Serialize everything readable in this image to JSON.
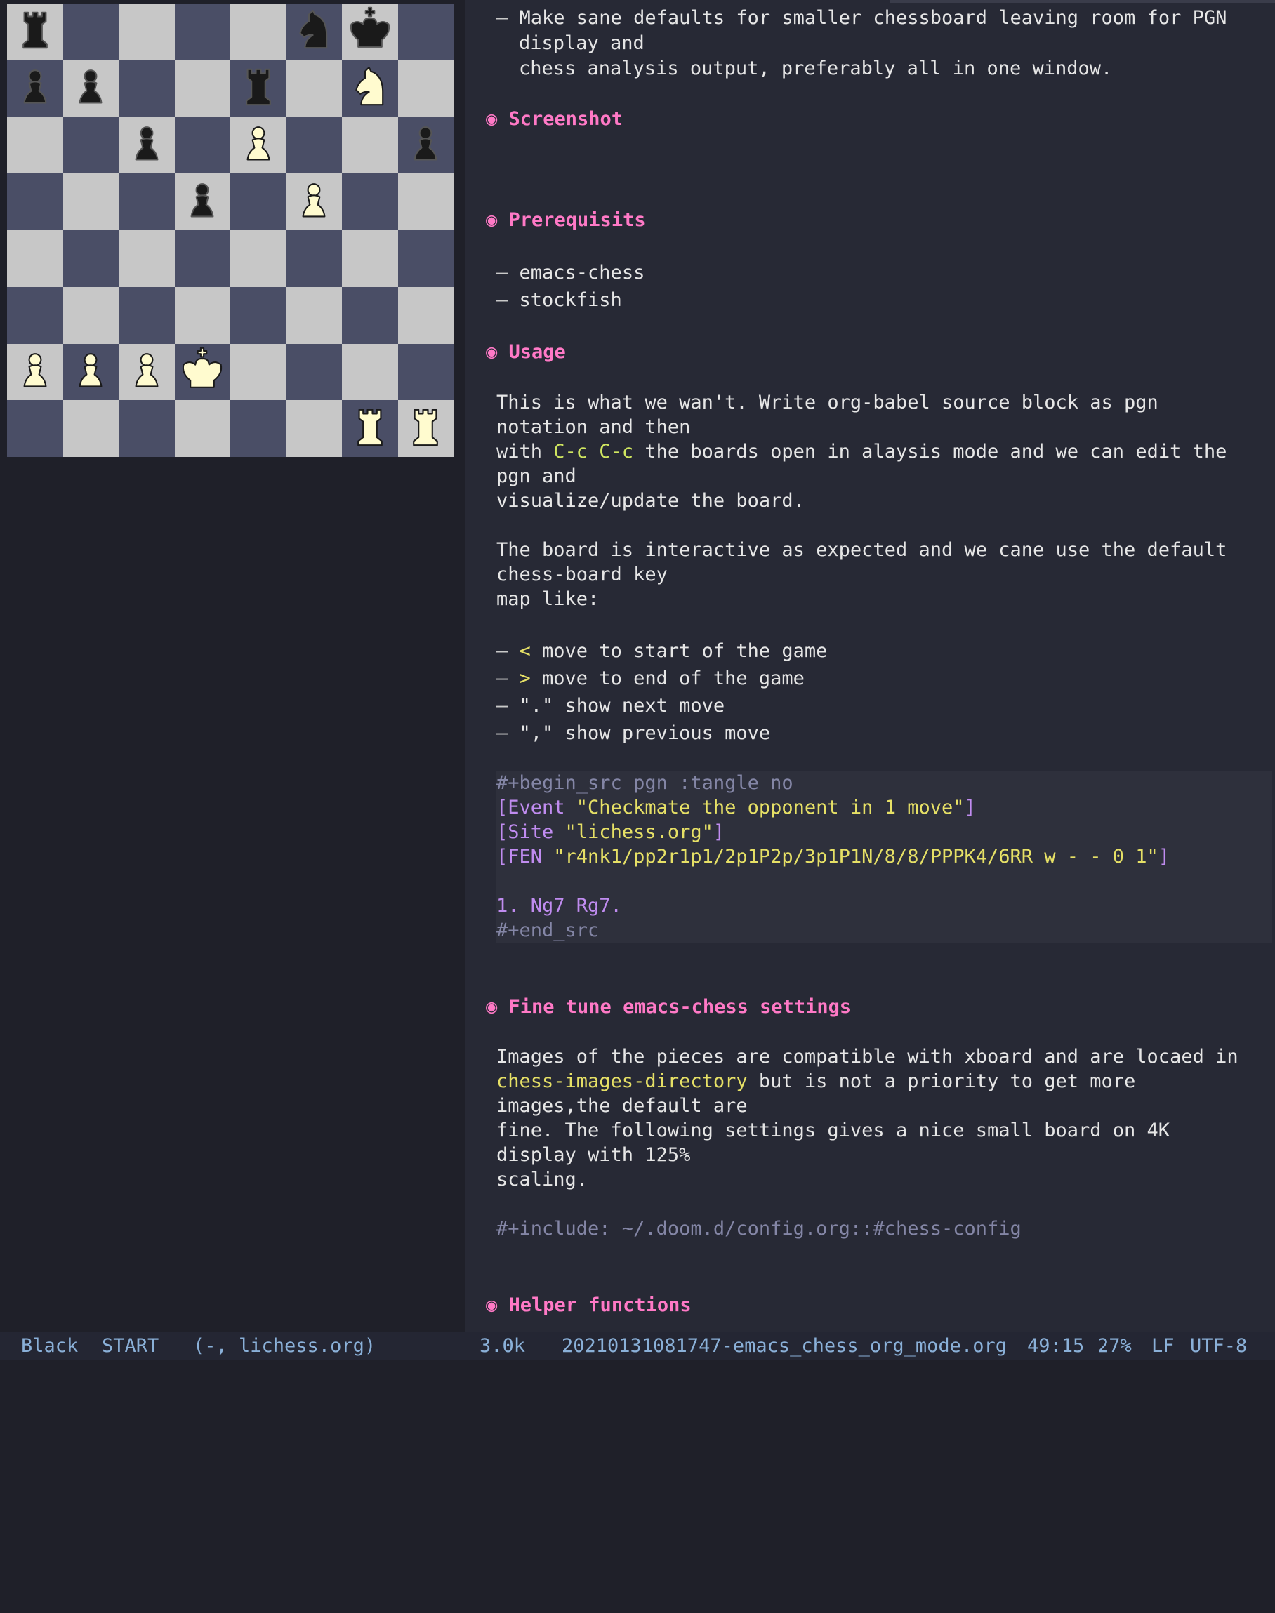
{
  "board": {
    "ranks": [
      [
        "br",
        "",
        "",
        "",
        "",
        "bn",
        "bk",
        ""
      ],
      [
        "bp",
        "bp",
        "",
        "",
        "br",
        "",
        "wn",
        ""
      ],
      [
        "",
        "",
        "bp",
        "",
        "wp",
        "",
        "",
        "bp"
      ],
      [
        "",
        "",
        "",
        "bp",
        "",
        "wp",
        "",
        ""
      ],
      [
        "",
        "",
        "",
        "",
        "",
        "",
        "",
        ""
      ],
      [
        "",
        "",
        "",
        "",
        "",
        "",
        "",
        ""
      ],
      [
        "wp",
        "wp",
        "wp",
        "wk",
        "",
        "",
        "",
        ""
      ],
      [
        "",
        "",
        "",
        "",
        "",
        "",
        "wr",
        "wr"
      ]
    ]
  },
  "doc": {
    "intro_line1": "Make sane defaults for smaller chessboard leaving room for PGN",
    "intro_line2": "display and",
    "intro_line3": "chess analysis output, preferably all in one window.",
    "h_screenshot": "Screenshot",
    "h_prereq": "Prerequisits",
    "prereq_1": "emacs-chess",
    "prereq_2": "stockfish",
    "h_usage": "Usage",
    "usage_p1_l1": "This is what we wan't. Write org-babel source block as pgn",
    "usage_p1_l2": "notation and then",
    "usage_p1_l3a": "with ",
    "usage_p1_l3_key": "C-c C-c",
    "usage_p1_l3b": " the boards open in alaysis mode and we can edit the",
    "usage_p1_l4": "pgn and",
    "usage_p1_l5": "visualize/update the board.",
    "usage_p2_l1": "The board is interactive as expected and we cane use the default",
    "usage_p2_l2": "chess-board key",
    "usage_p2_l3": "map like:",
    "keys": [
      {
        "key": "<",
        "desc": " move to start of the game"
      },
      {
        "key": ">",
        "desc": " move to end of the game"
      },
      {
        "key": "",
        "desc": "\".\" show next move"
      },
      {
        "key": "",
        "desc": "\",\" show previous move"
      }
    ],
    "src_begin": "#+begin_src pgn :tangle no",
    "src_event_tag": "[Event ",
    "src_event_val": "\"Checkmate the opponent in 1 move\"",
    "src_site_tag": "[Site ",
    "src_site_val": "\"lichess.org\"",
    "src_fen_tag": "[FEN ",
    "src_fen_val": "\"r4nk1/pp2r1p1/2p1P2p/3p1P1N/8/8/PPPK4/6RR w - - 0 1\"",
    "src_close": "]",
    "src_moves": "1. Ng7 Rg7.",
    "src_end": "#+end_src",
    "h_finetune": "Fine tune emacs-chess settings",
    "ft_l1": "Images of the pieces are compatible with xboard and are locaed in",
    "ft_l2_var": "chess-images-directory",
    "ft_l2_rest": " but is not a priority to get more",
    "ft_l3": "images,the default are",
    "ft_l4": "fine. The following settings gives a nice small board on 4K",
    "ft_l5": "display with 125%",
    "ft_l6": "scaling.",
    "include": "#+include: ~/.doom.d/config.org::#chess-config",
    "h_helper": "Helper functions"
  },
  "status": {
    "side": "Black",
    "ply": "START",
    "game": "(-, lichess.org)",
    "size": "3.0k",
    "filename": "20210131081747-emacs_chess_org_mode.org",
    "position": "49:15",
    "percent": "27%",
    "eol": "LF",
    "encoding": "UTF-8"
  },
  "colors": {
    "heading": "#ff79c6",
    "light_square": "#c7c7c7",
    "dark_square": "#4a4e66",
    "white_piece": "#fffbcf",
    "black_piece": "#1a1a1a"
  }
}
